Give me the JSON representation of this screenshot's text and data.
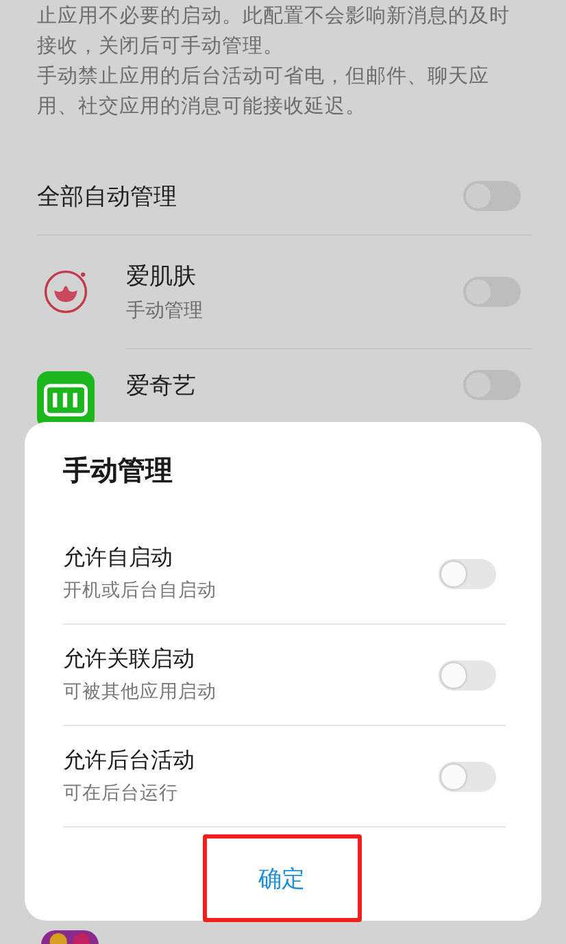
{
  "description": [
    "止应用不必要的启动。此配置不会影响新消息的及时接收，关闭后可手动管理。",
    "手动禁止应用的后台活动可省电，但邮件、聊天应用、社交应用的消息可能接收延迟。"
  ],
  "master": {
    "label": "全部自动管理",
    "on": false
  },
  "apps": [
    {
      "kind": "lotus",
      "name": "爱肌肤",
      "status": "手动管理",
      "on": false
    },
    {
      "kind": "iqiyi",
      "name": "爱奇艺",
      "on": false
    },
    {
      "kind": "game"
    }
  ],
  "dialog": {
    "title": "手动管理",
    "options": [
      {
        "label": "允许自启动",
        "hint": "开机或后台自启动",
        "on": false
      },
      {
        "label": "允许关联启动",
        "hint": "可被其他应用启动",
        "on": false
      },
      {
        "label": "允许后台活动",
        "hint": "可在后台运行",
        "on": false
      }
    ],
    "button": {
      "label": "确定",
      "highlighted": true
    }
  }
}
